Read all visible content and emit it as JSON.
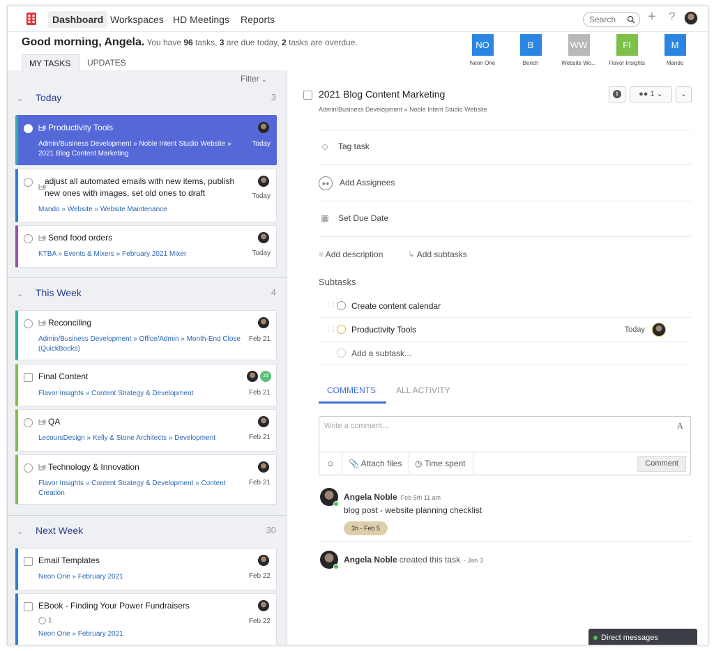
{
  "nav": {
    "items": [
      "Dashboard",
      "Workspaces",
      "HD Meetings",
      "Reports"
    ],
    "search_placeholder": "Search"
  },
  "greeting": {
    "hello": "Good morning, Angela.",
    "pre": "You have",
    "tasks": "96",
    "mid1": "tasks,",
    "due": "3",
    "mid2": "are due today,",
    "overdue": "2",
    "post": "tasks are overdue."
  },
  "tabs": [
    "MY TASKS",
    "UPDATES"
  ],
  "workspaces": [
    {
      "abbr": "NO",
      "name": "Neon One",
      "color": "#2b86e2"
    },
    {
      "abbr": "B",
      "name": "Bench",
      "color": "#2b86e2"
    },
    {
      "abbr": "WW",
      "name": "Website Wo...",
      "color": "#b8b8b8"
    },
    {
      "abbr": "FI",
      "name": "Flavor Insights",
      "color": "#7cc04b"
    },
    {
      "abbr": "M",
      "name": "Mando",
      "color": "#2b86e2"
    }
  ],
  "filter_label": "Filter",
  "groups": [
    {
      "title": "Today",
      "count": "3"
    },
    {
      "title": "This Week",
      "count": "4"
    },
    {
      "title": "Next Week",
      "count": "30"
    }
  ],
  "tasks": [
    {
      "title": "Productivity Tools",
      "path": "Admin/Business Development » Noble Intent Studio Website » 2021 Blog Content Marketing",
      "date": "Today",
      "accent": "#2bb3a0"
    },
    {
      "title": "adjust all automated emails with new items, publish new ones with images, set old ones to draft",
      "path": "Mando » Website » Website Maintenance",
      "date": "Today",
      "accent": "#2b7de0"
    },
    {
      "title": "Send food orders",
      "path": "KTBA » Events & Mixers » February 2021 Mixer",
      "date": "Today",
      "accent": "#9a4fb4"
    },
    {
      "title": "Reconciling",
      "path": "Admin/Business Development » Office/Admin » Month-End Close (QuickBooks)",
      "date": "Feb 21",
      "accent": "#2bb3a0"
    },
    {
      "title": "Final Content",
      "path": "Flavor Insights » Content Strategy & Development",
      "date": "Feb 21",
      "accent": "#7cc04b",
      "extra_avatar": "Jd"
    },
    {
      "title": "QA",
      "path": "LecoursDesign » Kelly & Stone Architects » Development",
      "date": "Feb 21",
      "accent": "#7cc04b"
    },
    {
      "title": "Technology & Innovation",
      "path": "Flavor Insights » Content Strategy & Development » Content Creation",
      "date": "Feb 21",
      "accent": "#7cc04b"
    },
    {
      "title": "Email Templates",
      "path": "Neon One » February 2021",
      "date": "Feb 22",
      "accent": "#2b7de0"
    },
    {
      "title": "EBook - Finding Your Power Fundraisers",
      "path": "Neon One » February 2021",
      "date": "Feb 22",
      "accent": "#2b7de0",
      "comments": "1"
    }
  ],
  "detail": {
    "title": "2021 Blog Content Marketing",
    "path": "Admin/Business Development » Noble Intent Studio Website",
    "assignee_count": "1",
    "tag_task": "Tag task",
    "add_assignees": "Add Assignees",
    "set_due_date": "Set Due Date",
    "add_description": "Add description",
    "add_subtasks": "Add subtasks",
    "subtasks_heading": "Subtasks",
    "subtasks": [
      {
        "title": "Create content calendar"
      },
      {
        "title": "Productivity Tools",
        "date": "Today"
      }
    ],
    "add_subtask_placeholder": "Add a subtask...",
    "tabs": [
      "COMMENTS",
      "ALL ACTIVITY"
    ],
    "comment_placeholder": "Write a comment...",
    "format_icon": "A",
    "attach_files": "Attach files",
    "time_spent": "Time spent",
    "comment_button": "Comment",
    "comments": [
      {
        "author": "Angela Noble",
        "time": "Feb 5th 11 am",
        "text": "blog post - website planning checklist",
        "pill": "3h - Feb 5"
      }
    ],
    "activity": {
      "author": "Angela Noble",
      "action": "created this task",
      "time": "- Jan 3"
    }
  },
  "direct_messages": "Direct messages"
}
